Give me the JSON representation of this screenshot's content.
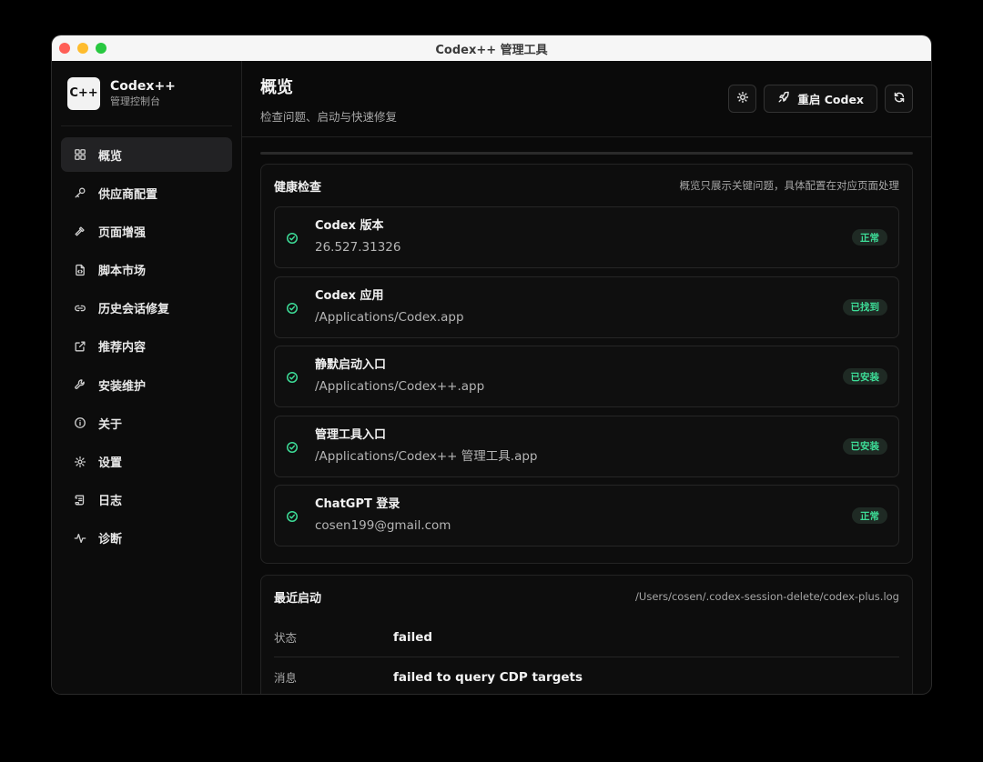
{
  "window": {
    "title": "Codex++ 管理工具"
  },
  "brand": {
    "logo_text": "C++",
    "name": "Codex++",
    "subtitle": "管理控制台"
  },
  "sidebar": {
    "items": [
      {
        "label": "概览",
        "icon": "grid-icon",
        "active": true
      },
      {
        "label": "供应商配置",
        "icon": "key-icon"
      },
      {
        "label": "页面增强",
        "icon": "hammer-icon"
      },
      {
        "label": "脚本市场",
        "icon": "file-code-icon"
      },
      {
        "label": "历史会话修复",
        "icon": "link-icon"
      },
      {
        "label": "推荐内容",
        "icon": "external-link-icon"
      },
      {
        "label": "安装维护",
        "icon": "wrench-icon"
      },
      {
        "label": "关于",
        "icon": "info-icon"
      },
      {
        "label": "设置",
        "icon": "gear-icon"
      },
      {
        "label": "日志",
        "icon": "scroll-icon"
      },
      {
        "label": "诊断",
        "icon": "activity-icon"
      }
    ]
  },
  "header": {
    "title": "概览",
    "subtitle": "检查问题、启动与快速修复",
    "restart_label": "重启 Codex"
  },
  "health": {
    "title": "健康检查",
    "note": "概览只展示关键问题，具体配置在对应页面处理",
    "checks": [
      {
        "name": "Codex 版本",
        "value": "26.527.31326",
        "status": "正常"
      },
      {
        "name": "Codex 应用",
        "value": "/Applications/Codex.app",
        "status": "已找到"
      },
      {
        "name": "静默启动入口",
        "value": "/Applications/Codex++.app",
        "status": "已安装"
      },
      {
        "name": "管理工具入口",
        "value": "/Applications/Codex++ 管理工具.app",
        "status": "已安装"
      },
      {
        "name": "ChatGPT 登录",
        "value": "cosen199@gmail.com",
        "status": "正常"
      }
    ]
  },
  "launch": {
    "title": "最近启动",
    "log_path": "/Users/cosen/.codex-session-delete/codex-plus.log",
    "rows": [
      {
        "label": "状态",
        "value": "failed"
      },
      {
        "label": "消息",
        "value": "failed to query CDP targets"
      }
    ]
  },
  "colors": {
    "success": "#3ddc97",
    "background": "#0a0a0a"
  }
}
